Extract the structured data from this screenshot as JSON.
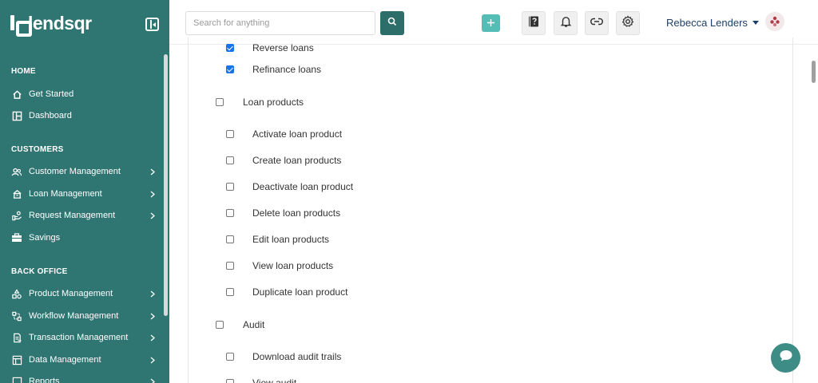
{
  "brand": {
    "name": "lendsqr"
  },
  "sidebar": {
    "sections": [
      {
        "title": "HOME",
        "items": [
          {
            "label": "Get Started",
            "icon": "home-icon",
            "chevron": false
          },
          {
            "label": "Dashboard",
            "icon": "dashboard-icon",
            "chevron": false
          }
        ]
      },
      {
        "title": "CUSTOMERS",
        "items": [
          {
            "label": "Customer Management",
            "icon": "users-icon",
            "chevron": true
          },
          {
            "label": "Loan Management",
            "icon": "loan-icon",
            "chevron": true
          },
          {
            "label": "Request Management",
            "icon": "request-icon",
            "chevron": true
          },
          {
            "label": "Savings",
            "icon": "savings-icon",
            "chevron": false
          }
        ]
      },
      {
        "title": "BACK OFFICE",
        "items": [
          {
            "label": "Product Management",
            "icon": "product-icon",
            "chevron": true
          },
          {
            "label": "Workflow Management",
            "icon": "workflow-icon",
            "chevron": true
          },
          {
            "label": "Transaction Management",
            "icon": "transaction-icon",
            "chevron": true
          },
          {
            "label": "Data Management",
            "icon": "data-icon",
            "chevron": true
          },
          {
            "label": "Reports",
            "icon": "reports-icon",
            "chevron": true
          }
        ]
      }
    ]
  },
  "header": {
    "search_placeholder": "Search for anything",
    "user_name": "Rebecca Lenders",
    "icons": [
      "search-icon",
      "plus-icon",
      "help-book-icon",
      "bell-icon",
      "link-icon",
      "gear-icon",
      "avatar"
    ]
  },
  "permissions": [
    {
      "label": "Reverse loans",
      "checked": true,
      "level": 1
    },
    {
      "label": "Refinance loans",
      "checked": true,
      "level": 1
    },
    {
      "label": "Loan products",
      "checked": false,
      "level": 0
    },
    {
      "label": "Activate loan product",
      "checked": false,
      "level": 1
    },
    {
      "label": "Create loan products",
      "checked": false,
      "level": 1
    },
    {
      "label": "Deactivate loan product",
      "checked": false,
      "level": 1
    },
    {
      "label": "Delete loan products",
      "checked": false,
      "level": 1
    },
    {
      "label": "Edit loan products",
      "checked": false,
      "level": 1
    },
    {
      "label": "View loan products",
      "checked": false,
      "level": 1
    },
    {
      "label": "Duplicate loan product",
      "checked": false,
      "level": 1
    },
    {
      "label": "Audit",
      "checked": false,
      "level": 0
    },
    {
      "label": "Download audit trails",
      "checked": false,
      "level": 1
    },
    {
      "label": "View audit",
      "checked": false,
      "level": 1
    }
  ],
  "colors": {
    "sidebar_bg": "#2f7572",
    "accent": "#54bdb5",
    "user_text": "#1e3f66",
    "checkbox_checked": "#1a73e8"
  }
}
